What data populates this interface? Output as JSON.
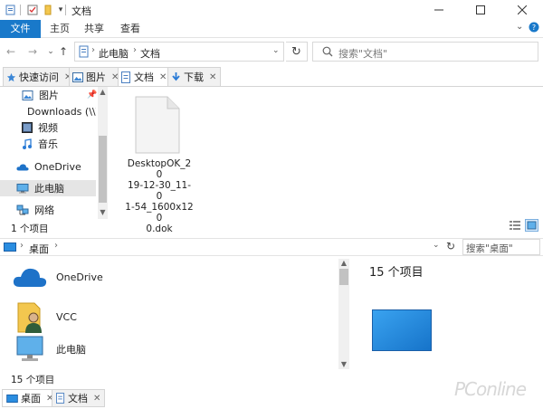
{
  "window": {
    "title": "文档"
  },
  "ribbon": {
    "tabs": [
      "文件",
      "主页",
      "共享",
      "查看"
    ]
  },
  "address": {
    "crumbs": [
      "此电脑",
      "文档"
    ]
  },
  "search": {
    "placeholder": "搜索\"文档\""
  },
  "tabs": [
    {
      "label": "快速访问",
      "active": false
    },
    {
      "label": "图片",
      "active": false
    },
    {
      "label": "文档",
      "active": true
    },
    {
      "label": "下载",
      "active": false
    }
  ],
  "nav": {
    "items": [
      {
        "label": "图片",
        "icon": "picture-icon",
        "pinned": true
      },
      {
        "label": "Downloads (\\\\V",
        "icon": "network-drive-icon"
      },
      {
        "label": "视频",
        "icon": "video-icon"
      },
      {
        "label": "音乐",
        "icon": "music-icon"
      },
      {
        "label": "OneDrive",
        "icon": "onedrive-icon"
      },
      {
        "label": "此电脑",
        "icon": "computer-icon",
        "selected": true
      },
      {
        "label": "网络",
        "icon": "network-icon"
      }
    ]
  },
  "file": {
    "name": "DesktopOK_2019-12-30_11-01-54_1600x1200.dok",
    "name_lines": [
      "DesktopOK_20",
      "19-12-30_11-0",
      "1-54_1600x120",
      "0.dok"
    ]
  },
  "status_top": "1 个项目",
  "bottom": {
    "crumb": "桌面",
    "search_placeholder": "搜索\"桌面\"",
    "items": [
      {
        "label": "OneDrive",
        "icon": "onedrive-icon"
      },
      {
        "label": "VCC",
        "icon": "user-folder-icon"
      },
      {
        "label": "此电脑",
        "icon": "computer-icon"
      }
    ],
    "preview_title": "15 个项目",
    "status": "15 个项目",
    "tabs": [
      {
        "label": "桌面",
        "active": true
      },
      {
        "label": "文档",
        "active": false
      }
    ]
  },
  "watermark": "PConline",
  "colors": {
    "accent": "#1979ca",
    "folder": "#f3c74f",
    "desktop": "#2a8de0"
  }
}
